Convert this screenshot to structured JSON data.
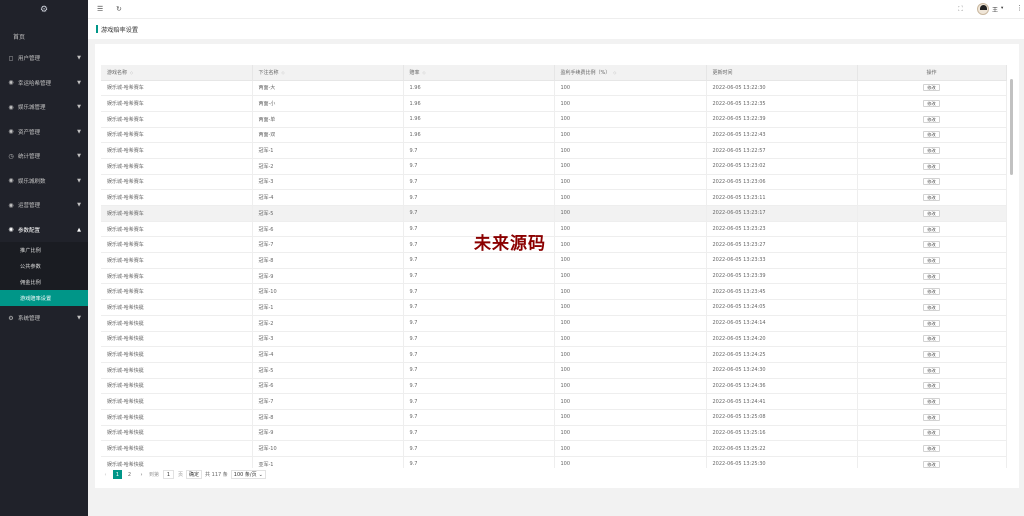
{
  "sidebar": {
    "logo_icon": "gear-icon",
    "home": "首页",
    "items": [
      {
        "icon": "◻",
        "label": "用户管理",
        "caret": "▼"
      },
      {
        "icon": "◉",
        "label": "幸运哈希管理",
        "caret": "▼"
      },
      {
        "icon": "◉",
        "label": "娱乐城管理",
        "caret": "▼"
      },
      {
        "icon": "◉",
        "label": "资产管理",
        "caret": "▼"
      },
      {
        "icon": "◷",
        "label": "统计管理",
        "caret": "▼"
      },
      {
        "icon": "◉",
        "label": "娱乐城刷数",
        "caret": "▼"
      },
      {
        "icon": "◉",
        "label": "运营管理",
        "caret": "▼"
      },
      {
        "icon": "◉",
        "label": "参数配置",
        "caret": "▲"
      }
    ],
    "sub_items": [
      "推广比例",
      "公共参数",
      "佣金比例",
      "游戏赔率设置"
    ],
    "last_item": {
      "icon": "⚙",
      "label": "系统管理",
      "caret": "▼"
    }
  },
  "header": {
    "menu_icon": "☰",
    "refresh_icon": "↻",
    "fullscreen_icon": "⛶",
    "user_name": "王",
    "user_caret": "▾",
    "more_icon": "⋮"
  },
  "tab": {
    "title": "游戏赔率设置"
  },
  "table": {
    "headers": [
      "游戏名称",
      "下注名称",
      "赔率",
      "盈利手续费比例（%）",
      "更新时间",
      "操作"
    ],
    "sort_glyph": "◇",
    "edit_label": "修改",
    "rows": [
      [
        "娱乐城-哈希赛车",
        "两面-大",
        "1.96",
        "100",
        "2022-06-05 13:22:30"
      ],
      [
        "娱乐城-哈希赛车",
        "两面-小",
        "1.96",
        "100",
        "2022-06-05 13:22:35"
      ],
      [
        "娱乐城-哈希赛车",
        "两面-单",
        "1.96",
        "100",
        "2022-06-05 13:22:39"
      ],
      [
        "娱乐城-哈希赛车",
        "两面-双",
        "1.96",
        "100",
        "2022-06-05 13:22:43"
      ],
      [
        "娱乐城-哈希赛车",
        "冠军-1",
        "9.7",
        "100",
        "2022-06-05 13:22:57"
      ],
      [
        "娱乐城-哈希赛车",
        "冠军-2",
        "9.7",
        "100",
        "2022-06-05 13:23:02"
      ],
      [
        "娱乐城-哈希赛车",
        "冠军-3",
        "9.7",
        "100",
        "2022-06-05 13:23:06"
      ],
      [
        "娱乐城-哈希赛车",
        "冠军-4",
        "9.7",
        "100",
        "2022-06-05 13:23:11"
      ],
      [
        "娱乐城-哈希赛车",
        "冠军-5",
        "9.7",
        "100",
        "2022-06-05 13:23:17"
      ],
      [
        "娱乐城-哈希赛车",
        "冠军-6",
        "9.7",
        "100",
        "2022-06-05 13:23:23"
      ],
      [
        "娱乐城-哈希赛车",
        "冠军-7",
        "9.7",
        "100",
        "2022-06-05 13:23:27"
      ],
      [
        "娱乐城-哈希赛车",
        "冠军-8",
        "9.7",
        "100",
        "2022-06-05 13:23:33"
      ],
      [
        "娱乐城-哈希赛车",
        "冠军-9",
        "9.7",
        "100",
        "2022-06-05 13:23:39"
      ],
      [
        "娱乐城-哈希赛车",
        "冠军-10",
        "9.7",
        "100",
        "2022-06-05 13:23:45"
      ],
      [
        "娱乐城-哈希快艇",
        "冠军-1",
        "9.7",
        "100",
        "2022-06-05 13:24:05"
      ],
      [
        "娱乐城-哈希快艇",
        "冠军-2",
        "9.7",
        "100",
        "2022-06-05 13:24:14"
      ],
      [
        "娱乐城-哈希快艇",
        "冠军-3",
        "9.7",
        "100",
        "2022-06-05 13:24:20"
      ],
      [
        "娱乐城-哈希快艇",
        "冠军-4",
        "9.7",
        "100",
        "2022-06-05 13:24:25"
      ],
      [
        "娱乐城-哈希快艇",
        "冠军-5",
        "9.7",
        "100",
        "2022-06-05 13:24:30"
      ],
      [
        "娱乐城-哈希快艇",
        "冠军-6",
        "9.7",
        "100",
        "2022-06-05 13:24:36"
      ],
      [
        "娱乐城-哈希快艇",
        "冠军-7",
        "9.7",
        "100",
        "2022-06-05 13:24:41"
      ],
      [
        "娱乐城-哈希快艇",
        "冠军-8",
        "9.7",
        "100",
        "2022-06-05 13:25:08"
      ],
      [
        "娱乐城-哈希快艇",
        "冠军-9",
        "9.7",
        "100",
        "2022-06-05 13:25:16"
      ],
      [
        "娱乐城-哈希快艇",
        "冠军-10",
        "9.7",
        "100",
        "2022-06-05 13:25:22"
      ],
      [
        "娱乐城-哈希快艇",
        "亚军-1",
        "9.7",
        "100",
        "2022-06-05 13:25:30"
      ]
    ]
  },
  "pager": {
    "prev": "‹",
    "pages": [
      "1",
      "2"
    ],
    "next": "›",
    "goto_label": "到第",
    "goto_value": "1",
    "page_unit": "页",
    "confirm": "确定",
    "total": "共 117 条",
    "per_page": "100 条/页",
    "per_page_caret": "⌄"
  },
  "watermark": "未来源码",
  "colors": {
    "accent": "#009688",
    "sidebar": "#20222a",
    "watermark": "#8b0000"
  }
}
